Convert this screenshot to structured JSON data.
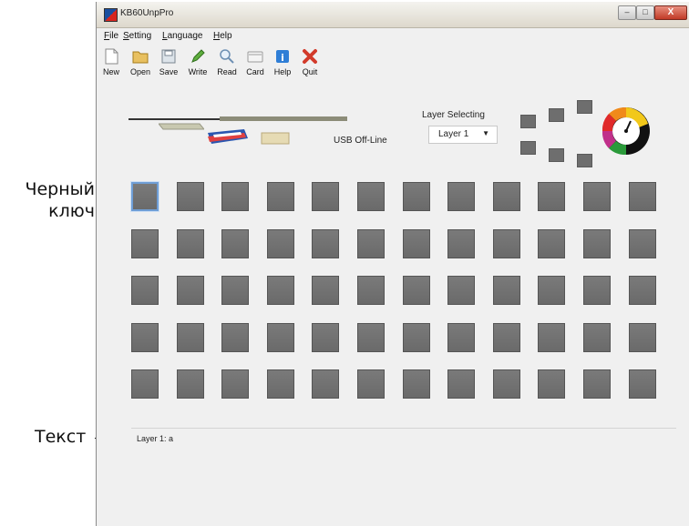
{
  "annotations": {
    "black_key_line1": "Черный",
    "black_key_line2": "ключ",
    "text_label": "Текст"
  },
  "window": {
    "title": "KB60UnpPro",
    "controls": {
      "minimize": "–",
      "maximize": "□",
      "close": "X"
    }
  },
  "menu": [
    "File",
    "Setting",
    "Language",
    "Help"
  ],
  "toolbar": [
    {
      "label": "New",
      "icon": "new-file-icon"
    },
    {
      "label": "Open",
      "icon": "folder-open-icon"
    },
    {
      "label": "Save",
      "icon": "save-icon"
    },
    {
      "label": "Write",
      "icon": "pencil-icon"
    },
    {
      "label": "Read",
      "icon": "magnifier-icon"
    },
    {
      "label": "Card",
      "icon": "card-icon"
    },
    {
      "label": "Help",
      "icon": "help-icon"
    },
    {
      "label": "Quit",
      "icon": "quit-x-icon"
    }
  ],
  "device": {
    "status": "USB Off-Line",
    "layer_caption": "Layer Selecting",
    "layer_value": "Layer 1"
  },
  "keys": {
    "rows": 5,
    "cols": 12,
    "selected_row": 0,
    "selected_col": 0
  },
  "info": "Layer 1: a",
  "colors": {
    "key": "#707070",
    "selected_border": "#6f9ed6",
    "window_bg": "#f0f0f0"
  }
}
